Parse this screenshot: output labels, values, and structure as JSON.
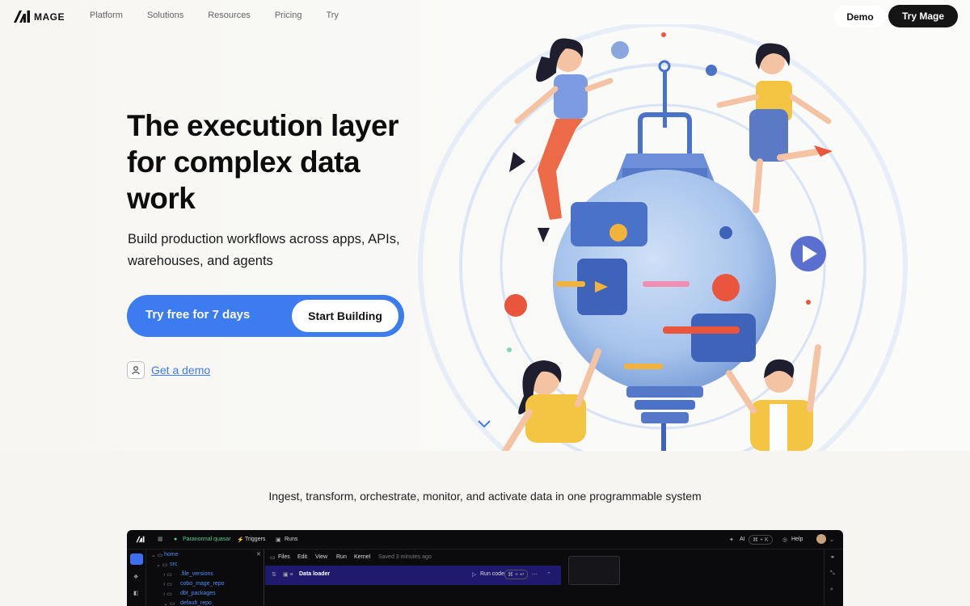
{
  "nav": {
    "logo_text": "MAGE",
    "links": [
      "Platform",
      "Solutions",
      "Resources",
      "Pricing",
      "Try"
    ],
    "demo_label": "Demo",
    "try_label": "Try Mage"
  },
  "hero": {
    "title": "The execution layer for complex data work",
    "subtitle": "Build production workflows across apps, APIs, warehouses, and agents",
    "cta_free": "Try free for 7 days",
    "cta_start": "Start Building",
    "demo_link": "Get a demo"
  },
  "section2": {
    "tagline": "Ingest, transform, orchestrate, monitor, and activate data in one programmable system"
  },
  "app_preview": {
    "project": "Paranormal quasar",
    "triggers": "Triggers",
    "runs": "Runs",
    "ai": "AI",
    "ai_shortcut": "⌘ + K",
    "help": "Help",
    "tree": [
      "home",
      "src",
      ".file_versions",
      "cobo_mage_repo",
      "dbt_packages",
      "default_repo"
    ],
    "menu": [
      "Files",
      "Edit",
      "View",
      "Run",
      "Kernel"
    ],
    "saved": "Saved 3 minutes ago",
    "block_name": "Data loader",
    "run_code": "Run code",
    "run_shortcut": "⌘ + ↵"
  },
  "colors": {
    "accent": "#3c7cf0",
    "dark": "#151515",
    "app_bg": "#0b0b0e",
    "block_bg": "#1f1a6e"
  }
}
